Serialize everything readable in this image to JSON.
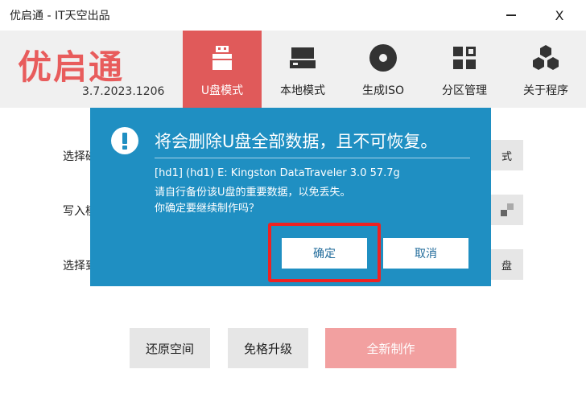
{
  "window": {
    "title": "优启通 - IT天空出品",
    "minimize_icon": "minimize-icon",
    "close_label": "X"
  },
  "header": {
    "logo": "优启通",
    "version": "3.7.2023.1206",
    "accent_color": "#e05a5a",
    "nav": [
      {
        "label": "U盘模式",
        "icon": "usb-drive-icon",
        "active": true
      },
      {
        "label": "本地模式",
        "icon": "hard-disk-icon",
        "active": false
      },
      {
        "label": "生成ISO",
        "icon": "disc-icon",
        "active": false
      },
      {
        "label": "分区管理",
        "icon": "grid-icon",
        "active": false
      },
      {
        "label": "关于程序",
        "icon": "hexagon-cluster-icon",
        "active": false
      }
    ]
  },
  "main": {
    "rows": [
      {
        "label": "选择磁",
        "side_button": "式"
      },
      {
        "label": "写入模",
        "side_button": ""
      },
      {
        "label": "选择到",
        "side_button": "盘"
      }
    ],
    "buttons": {
      "restore": "还原空间",
      "upgrade": "免格升级",
      "create": "全新制作"
    }
  },
  "dialog": {
    "title": "将会删除U盘全部数据，且不可恢复。",
    "icon": "warning-icon",
    "lines": [
      "[hd1] (hd1) E: Kingston DataTraveler 3.0 57.7g",
      "请自行备份该U盘的重要数据，以免丢失。",
      "你确定要继续制作吗？"
    ],
    "ok_label": "确定",
    "cancel_label": "取消",
    "color": "#1f8fc2",
    "highlight_color": "#ee2222"
  }
}
